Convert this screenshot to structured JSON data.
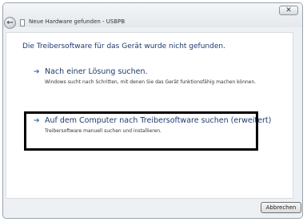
{
  "window": {
    "title": "Neue Hardware gefunden - USBPB",
    "close_label": "✕",
    "back_label": "←"
  },
  "content": {
    "heading": "Die Treibersoftware für das Gerät wurde nicht gefunden.",
    "options": [
      {
        "arrow": "➔",
        "title": "Nach einer Lösung suchen.",
        "description": "Windows sucht nach Schritten, mit denen Sie das Gerät funktionsfähig machen können."
      },
      {
        "arrow": "➔",
        "title": "Auf dem Computer nach Treibersoftware suchen (erweitert)",
        "description": "Treibersoftware manuell suchen und installieren."
      }
    ]
  },
  "footer": {
    "cancel_label": "Abbrechen"
  },
  "colors": {
    "heading": "#1e3a6e",
    "arrow": "#2e6db5",
    "highlight_border": "#000000"
  }
}
